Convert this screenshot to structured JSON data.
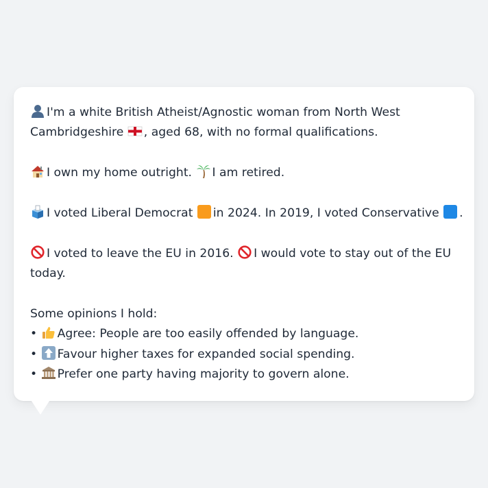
{
  "profile": {
    "line1": "I'm a white British Atheist/Agnostic woman from North West Cambridgeshire",
    "line1_tail": ", aged 68, with no formal qualifications.",
    "home": "I own my home outright.",
    "retired": "I am retired.",
    "vote_a": "I voted Liberal Democrat",
    "vote_b": "in 2024. In 2019, I voted Conservative",
    "vote_end": ".",
    "eu_a": "I voted to leave the EU in 2016.",
    "eu_b": "I would vote to stay out of the EU today."
  },
  "opinions": {
    "heading": "Some opinions I hold:",
    "items": [
      {
        "text": "Agree: People are too easily offended by language.",
        "icon": "thumbs-up-icon"
      },
      {
        "text": "Favour higher taxes for expanded social spending.",
        "icon": "up-arrow-icon"
      },
      {
        "text": "Prefer one party having majority to govern alone.",
        "icon": "classical-building-icon"
      }
    ],
    "bullet": "•"
  },
  "icons": {
    "person": "bust-silhouette-icon",
    "flag": "england-flag-icon",
    "home": "house-icon",
    "retired": "palm-tree-icon",
    "ballot": "ballot-box-icon",
    "libdem": "orange-square-icon",
    "conservative": "blue-square-icon",
    "eu": "prohibited-icon"
  },
  "colors": {
    "background": "#f1f3f5",
    "card": "#ffffff",
    "text": "#1f2937",
    "libdem": "#f99b1c",
    "conservative": "#1e88e5",
    "prohibited": "#e0252b"
  }
}
